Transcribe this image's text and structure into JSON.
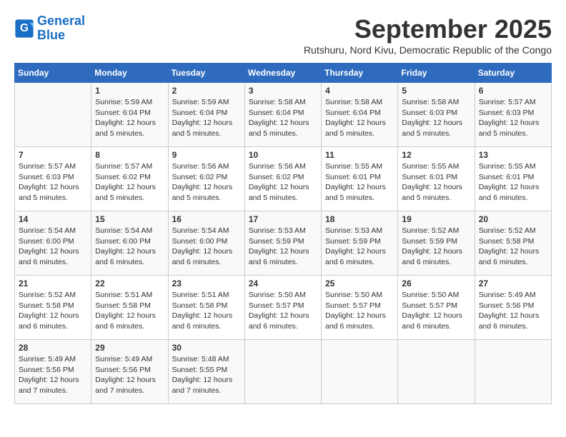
{
  "logo": {
    "line1": "General",
    "line2": "Blue"
  },
  "title": "September 2025",
  "subtitle": "Rutshuru, Nord Kivu, Democratic Republic of the Congo",
  "headers": [
    "Sunday",
    "Monday",
    "Tuesday",
    "Wednesday",
    "Thursday",
    "Friday",
    "Saturday"
  ],
  "weeks": [
    [
      {
        "day": "",
        "info": ""
      },
      {
        "day": "1",
        "info": "Sunrise: 5:59 AM\nSunset: 6:04 PM\nDaylight: 12 hours\nand 5 minutes."
      },
      {
        "day": "2",
        "info": "Sunrise: 5:59 AM\nSunset: 6:04 PM\nDaylight: 12 hours\nand 5 minutes."
      },
      {
        "day": "3",
        "info": "Sunrise: 5:58 AM\nSunset: 6:04 PM\nDaylight: 12 hours\nand 5 minutes."
      },
      {
        "day": "4",
        "info": "Sunrise: 5:58 AM\nSunset: 6:04 PM\nDaylight: 12 hours\nand 5 minutes."
      },
      {
        "day": "5",
        "info": "Sunrise: 5:58 AM\nSunset: 6:03 PM\nDaylight: 12 hours\nand 5 minutes."
      },
      {
        "day": "6",
        "info": "Sunrise: 5:57 AM\nSunset: 6:03 PM\nDaylight: 12 hours\nand 5 minutes."
      }
    ],
    [
      {
        "day": "7",
        "info": "Sunrise: 5:57 AM\nSunset: 6:03 PM\nDaylight: 12 hours\nand 5 minutes."
      },
      {
        "day": "8",
        "info": "Sunrise: 5:57 AM\nSunset: 6:02 PM\nDaylight: 12 hours\nand 5 minutes."
      },
      {
        "day": "9",
        "info": "Sunrise: 5:56 AM\nSunset: 6:02 PM\nDaylight: 12 hours\nand 5 minutes."
      },
      {
        "day": "10",
        "info": "Sunrise: 5:56 AM\nSunset: 6:02 PM\nDaylight: 12 hours\nand 5 minutes."
      },
      {
        "day": "11",
        "info": "Sunrise: 5:55 AM\nSunset: 6:01 PM\nDaylight: 12 hours\nand 5 minutes."
      },
      {
        "day": "12",
        "info": "Sunrise: 5:55 AM\nSunset: 6:01 PM\nDaylight: 12 hours\nand 5 minutes."
      },
      {
        "day": "13",
        "info": "Sunrise: 5:55 AM\nSunset: 6:01 PM\nDaylight: 12 hours\nand 6 minutes."
      }
    ],
    [
      {
        "day": "14",
        "info": "Sunrise: 5:54 AM\nSunset: 6:00 PM\nDaylight: 12 hours\nand 6 minutes."
      },
      {
        "day": "15",
        "info": "Sunrise: 5:54 AM\nSunset: 6:00 PM\nDaylight: 12 hours\nand 6 minutes."
      },
      {
        "day": "16",
        "info": "Sunrise: 5:54 AM\nSunset: 6:00 PM\nDaylight: 12 hours\nand 6 minutes."
      },
      {
        "day": "17",
        "info": "Sunrise: 5:53 AM\nSunset: 5:59 PM\nDaylight: 12 hours\nand 6 minutes."
      },
      {
        "day": "18",
        "info": "Sunrise: 5:53 AM\nSunset: 5:59 PM\nDaylight: 12 hours\nand 6 minutes."
      },
      {
        "day": "19",
        "info": "Sunrise: 5:52 AM\nSunset: 5:59 PM\nDaylight: 12 hours\nand 6 minutes."
      },
      {
        "day": "20",
        "info": "Sunrise: 5:52 AM\nSunset: 5:58 PM\nDaylight: 12 hours\nand 6 minutes."
      }
    ],
    [
      {
        "day": "21",
        "info": "Sunrise: 5:52 AM\nSunset: 5:58 PM\nDaylight: 12 hours\nand 6 minutes."
      },
      {
        "day": "22",
        "info": "Sunrise: 5:51 AM\nSunset: 5:58 PM\nDaylight: 12 hours\nand 6 minutes."
      },
      {
        "day": "23",
        "info": "Sunrise: 5:51 AM\nSunset: 5:58 PM\nDaylight: 12 hours\nand 6 minutes."
      },
      {
        "day": "24",
        "info": "Sunrise: 5:50 AM\nSunset: 5:57 PM\nDaylight: 12 hours\nand 6 minutes."
      },
      {
        "day": "25",
        "info": "Sunrise: 5:50 AM\nSunset: 5:57 PM\nDaylight: 12 hours\nand 6 minutes."
      },
      {
        "day": "26",
        "info": "Sunrise: 5:50 AM\nSunset: 5:57 PM\nDaylight: 12 hours\nand 6 minutes."
      },
      {
        "day": "27",
        "info": "Sunrise: 5:49 AM\nSunset: 5:56 PM\nDaylight: 12 hours\nand 6 minutes."
      }
    ],
    [
      {
        "day": "28",
        "info": "Sunrise: 5:49 AM\nSunset: 5:56 PM\nDaylight: 12 hours\nand 7 minutes."
      },
      {
        "day": "29",
        "info": "Sunrise: 5:49 AM\nSunset: 5:56 PM\nDaylight: 12 hours\nand 7 minutes."
      },
      {
        "day": "30",
        "info": "Sunrise: 5:48 AM\nSunset: 5:55 PM\nDaylight: 12 hours\nand 7 minutes."
      },
      {
        "day": "",
        "info": ""
      },
      {
        "day": "",
        "info": ""
      },
      {
        "day": "",
        "info": ""
      },
      {
        "day": "",
        "info": ""
      }
    ]
  ]
}
